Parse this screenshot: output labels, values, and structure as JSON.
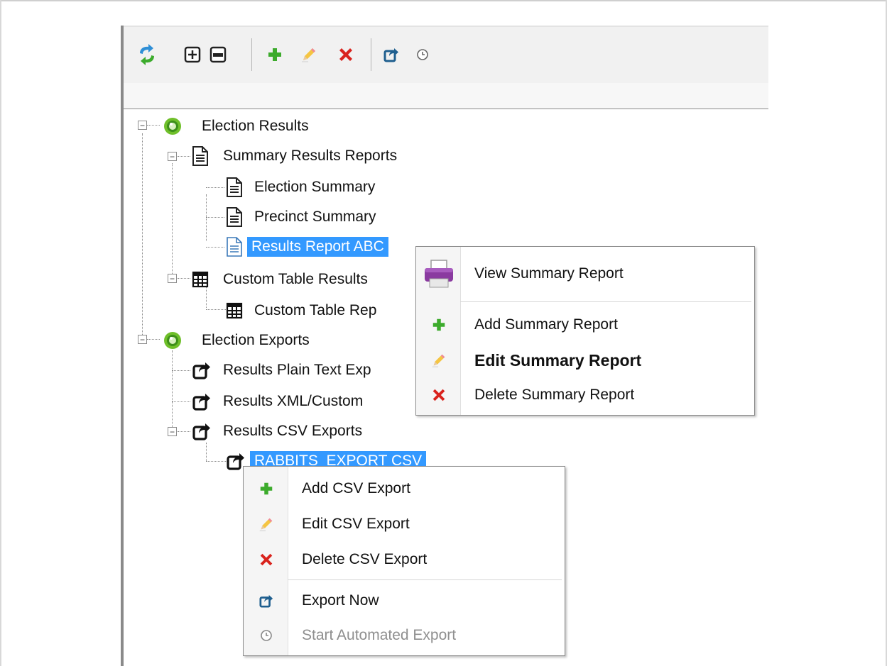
{
  "colors": {
    "selection": "#3399ff",
    "accent_green": "#3cab2c",
    "delete_red": "#d9231d"
  },
  "toolbar": {
    "buttons": [
      {
        "name": "refresh",
        "icon": "refresh-arrows-icon"
      },
      {
        "name": "expand-all",
        "icon": "plus-box-icon"
      },
      {
        "name": "collapse-all",
        "icon": "minus-box-icon"
      },
      {
        "name": "add",
        "icon": "green-plus-icon"
      },
      {
        "name": "edit",
        "icon": "pencil-icon"
      },
      {
        "name": "delete",
        "icon": "red-x-icon"
      },
      {
        "name": "export",
        "icon": "export-arrow-icon"
      },
      {
        "name": "schedule",
        "icon": "clock-icon"
      }
    ]
  },
  "tree": {
    "election_results": "Election Results",
    "summary_results_reports": "Summary Results Reports",
    "election_summary": "Election Summary",
    "precinct_summary": "Precinct Summary",
    "results_report_abc": "Results Report ABC",
    "custom_table_results": "Custom Table Results",
    "custom_table_rep": "Custom Table Rep",
    "election_exports": "Election Exports",
    "results_plain_text": "Results Plain Text Exp",
    "results_xml_custom": "Results XML/Custom",
    "results_csv_exports": "Results CSV Exports",
    "rabbits_export_csv": "RABBITS_EXPORT CSV"
  },
  "summary_menu": {
    "view": "View Summary Report",
    "add": "Add Summary Report",
    "edit": "Edit Summary Report",
    "delete": "Delete Summary Report"
  },
  "csv_menu": {
    "add": "Add CSV Export",
    "edit": "Edit CSV Export",
    "delete": "Delete CSV Export",
    "export_now": "Export Now",
    "start_automated": "Start Automated Export"
  }
}
